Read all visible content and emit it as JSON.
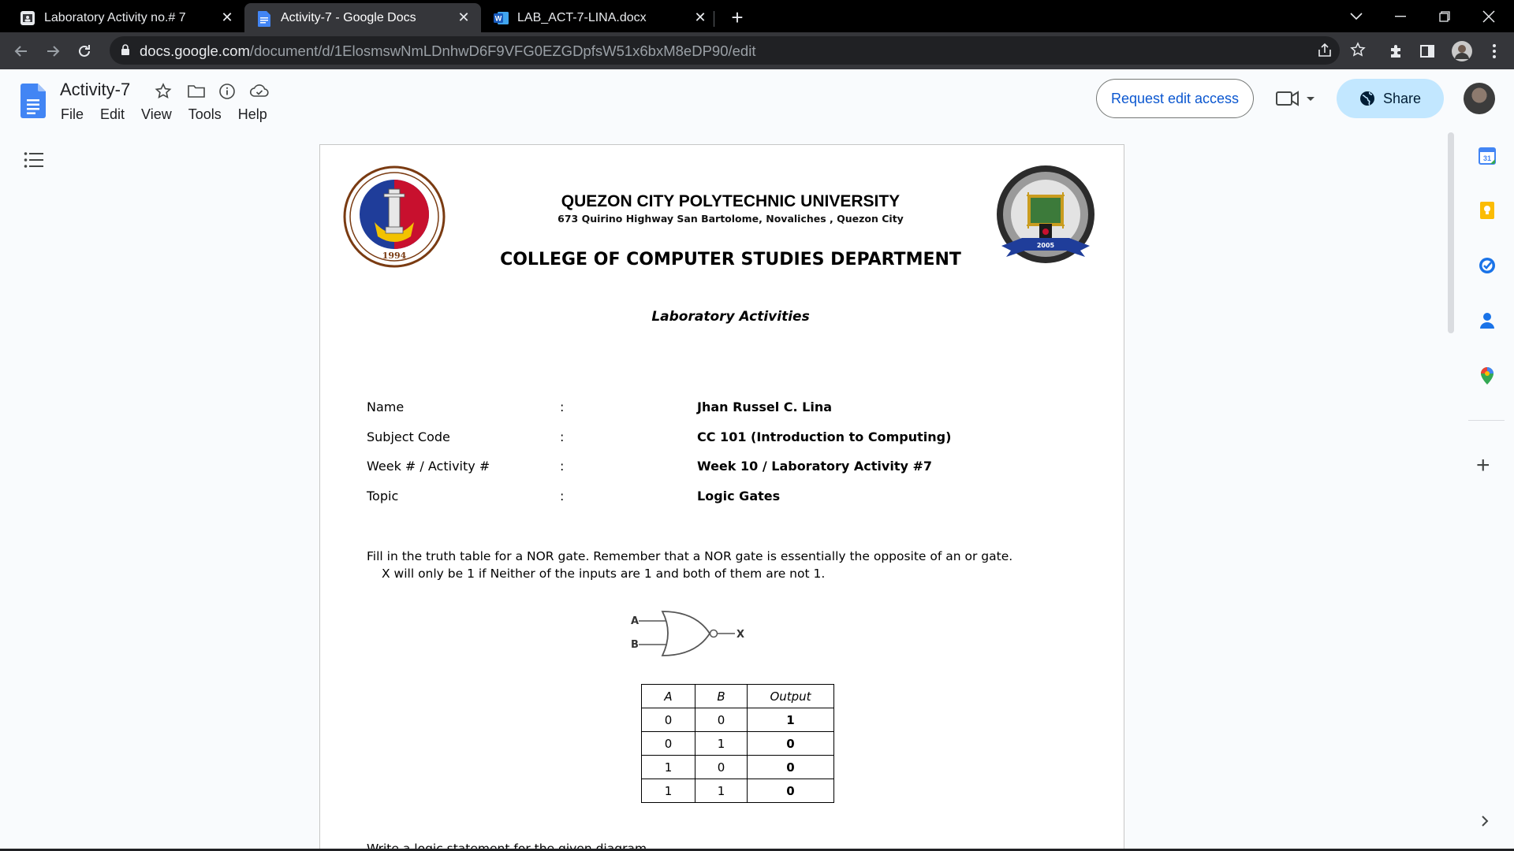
{
  "browser": {
    "tabs": [
      {
        "title": "Laboratory Activity no.# 7",
        "active": false,
        "icon": "classroom-icon"
      },
      {
        "title": "Activity-7 - Google Docs",
        "active": true,
        "icon": "google-docs-icon"
      },
      {
        "title": "LAB_ACT-7-LINA.docx",
        "active": false,
        "icon": "word-icon"
      }
    ],
    "url_host": "docs.google.com",
    "url_path": "/document/d/1ElosmswNmLDnhwD6F9VFG0EZGDpfsW51x6bxM8eDP90/edit"
  },
  "docs": {
    "title": "Activity-7",
    "menu": [
      "File",
      "Edit",
      "View",
      "Tools",
      "Help"
    ],
    "request_edit_label": "Request edit access",
    "share_label": "Share",
    "accent_color": "#0b57d0",
    "share_bg": "#c2e7ff"
  },
  "document": {
    "logo_left_year": "1994",
    "logo_right_year": "2005",
    "university": "QUEZON CITY POLYTECHNIC UNIVERSITY",
    "address": "673 Quirino Highway San Bartolome, Novaliches , Quezon City",
    "college": "COLLEGE OF COMPUTER STUDIES DEPARTMENT",
    "lab_title": "Laboratory Activities",
    "info": [
      {
        "label": "Name",
        "colon": ":",
        "value": "Jhan Russel C. Lina"
      },
      {
        "label": "Subject Code",
        "colon": ":",
        "value": "CC 101 (Introduction to Computing)"
      },
      {
        "label": "Week # / Activity #",
        "colon": ":",
        "value": "Week 10 / Laboratory Activity #7"
      },
      {
        "label": "Topic",
        "colon": ":",
        "value": "Logic Gates"
      }
    ],
    "instruction_1": "Fill in the truth table for a NOR gate.  Remember that a NOR gate is essentially the opposite of an or gate.",
    "instruction_2": "X will only be 1 if Neither of the inputs are 1 and both of them are not 1.",
    "gate_labels": {
      "a": "A",
      "b": "B",
      "x": "X"
    },
    "truth_table": {
      "headers": [
        "A",
        "B",
        "Output"
      ],
      "rows": [
        [
          "0",
          "0",
          "1"
        ],
        [
          "0",
          "1",
          "0"
        ],
        [
          "1",
          "0",
          "0"
        ],
        [
          "1",
          "1",
          "0"
        ]
      ]
    },
    "next_line": "Write a logic statement for the given diagram"
  },
  "side_panel": {
    "icons": [
      "calendar-icon",
      "keep-icon",
      "tasks-icon",
      "contacts-icon",
      "maps-icon"
    ],
    "calendar_day": "31",
    "add_label": "+"
  }
}
